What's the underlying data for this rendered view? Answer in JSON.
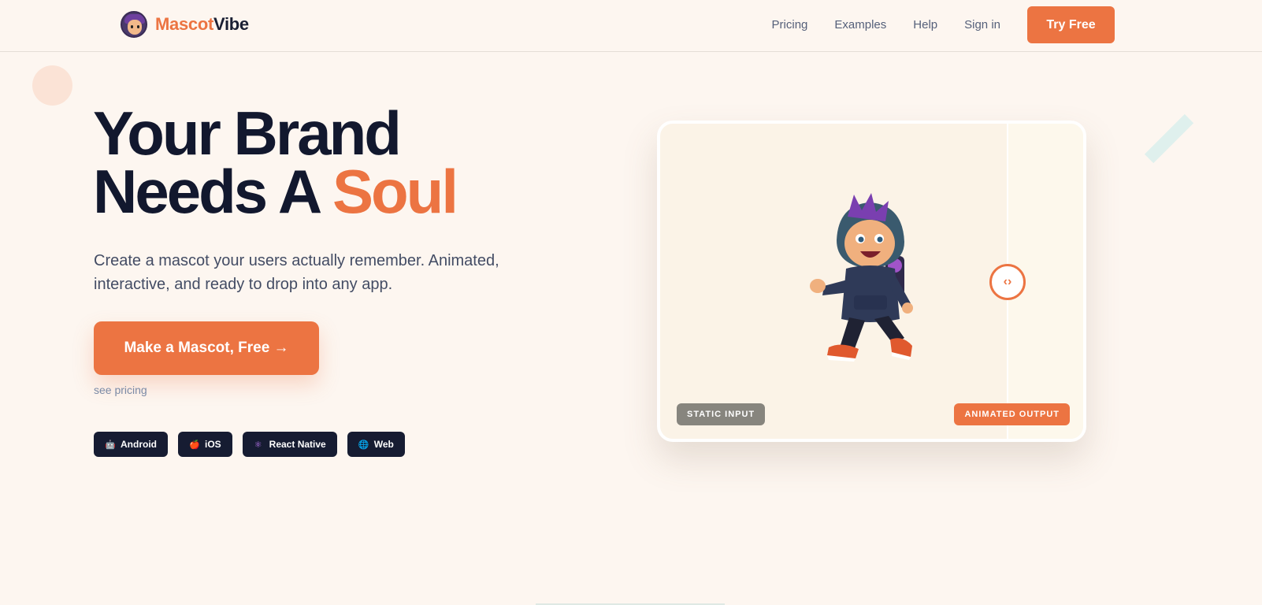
{
  "brand": {
    "part1": "Mascot",
    "part2": "Vibe",
    "accent": "#ec7442"
  },
  "nav": {
    "links": [
      "Pricing",
      "Examples",
      "Help",
      "Sign in"
    ],
    "cta": "Try Free"
  },
  "hero": {
    "title_line1": "Your Brand",
    "title_line2_prefix": "Needs A ",
    "title_line2_accent": "Soul",
    "subtitle": "Create a mascot your users actually remember. Animated, interactive, and ready to drop into any app.",
    "cta": "Make a Mascot, Free →",
    "secondary_link": "see pricing"
  },
  "platforms": [
    {
      "icon": "robot-icon",
      "glyph": "🤖",
      "label": "Android"
    },
    {
      "icon": "apple-icon",
      "glyph": "🍎",
      "label": "iOS"
    },
    {
      "icon": "atom-icon",
      "glyph": "⚛",
      "label": "React Native"
    },
    {
      "icon": "globe-icon",
      "glyph": "🌐",
      "label": "Web"
    }
  ],
  "preview": {
    "left_badge": "STATIC INPUT",
    "right_badge": "ANIMATED OUTPUT",
    "handle_glyph": "‹›"
  },
  "colors": {
    "background": "#fdf6f0",
    "accent": "#ec7442",
    "dark": "#161c32"
  }
}
